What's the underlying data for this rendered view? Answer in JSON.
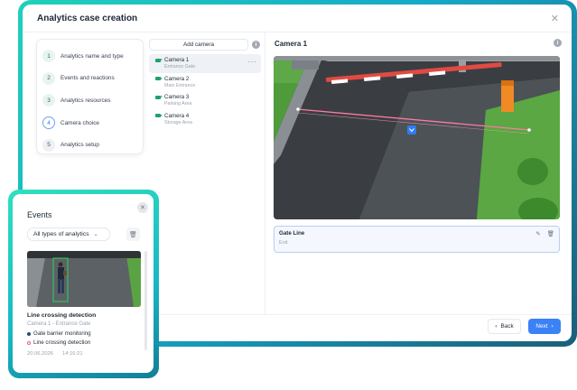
{
  "window": {
    "title": "Analytics case creation"
  },
  "steps": [
    {
      "num": "1",
      "label": "Analytics name and type",
      "state": "done"
    },
    {
      "num": "2",
      "label": "Events and reactions",
      "state": "done"
    },
    {
      "num": "3",
      "label": "Analytics resources",
      "state": "done"
    },
    {
      "num": "4",
      "label": "Camera choice",
      "state": "active"
    },
    {
      "num": "5",
      "label": "Analytics setup",
      "state": "todo"
    }
  ],
  "cameras": {
    "add_label": "Add camera",
    "items": [
      {
        "name": "Camera 1",
        "location": "Entrance Gate",
        "more": "···"
      },
      {
        "name": "Camera 2",
        "location": "Main Entrance"
      },
      {
        "name": "Camera 3",
        "location": "Parking Area"
      },
      {
        "name": "Camera 4",
        "location": "Storage Area"
      }
    ]
  },
  "detail": {
    "title": "Camera 1",
    "info": "i",
    "line": {
      "title": "Gate Line",
      "placeholder": "Exit"
    }
  },
  "footer": {
    "back": "Back",
    "next": "Next"
  },
  "events": {
    "title": "Events",
    "filter": "All types of analytics",
    "event": {
      "title": "Line crossing detection",
      "camera": "Camera 1 - Entrance Gate",
      "tags": [
        "Gate barrier monitoring",
        "Line crossing detection"
      ],
      "date": "20.06.2026",
      "time": "14:16:21"
    }
  },
  "icons": {
    "close": "close-icon",
    "info": "info-icon",
    "camera": "camera-icon",
    "edit": "edit-icon",
    "trash": "trash-icon",
    "chevron": "chevron-down-icon"
  },
  "colors": {
    "accent": "#3b82f6",
    "frame_gradient_start": "#1fd1b9",
    "frame_gradient_end": "#1a5f7a",
    "line": "#e6627a",
    "camera_green": "#22a06b"
  }
}
